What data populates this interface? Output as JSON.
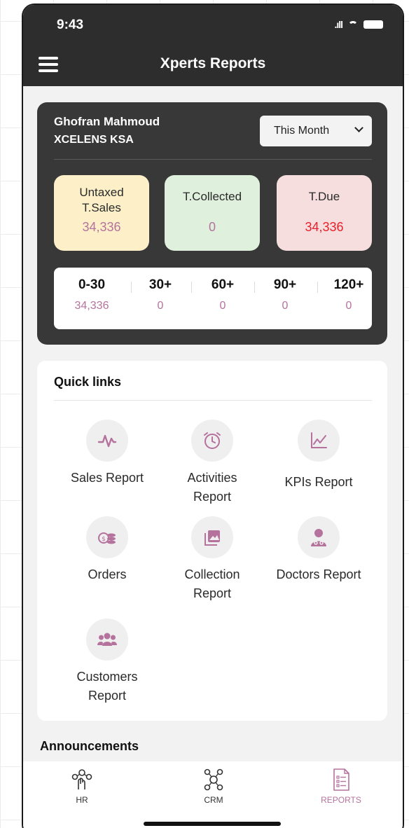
{
  "status_bar": {
    "time": "9:43",
    "signal": ".ıll"
  },
  "header": {
    "title": "Xperts Reports"
  },
  "summary": {
    "user_name": "Ghofran Mahmoud",
    "company": "XCELENS KSA",
    "period": "This Month",
    "stats": {
      "sales_label_1": "Untaxed",
      "sales_label_2": "T.Sales",
      "sales_value": "34,336",
      "collected_label": "T.Collected",
      "collected_value": "0",
      "due_label": "T.Due",
      "due_value": "34,336"
    },
    "aging": [
      {
        "bucket": "0-30",
        "amount": "34,336"
      },
      {
        "bucket": "30+",
        "amount": "0"
      },
      {
        "bucket": "60+",
        "amount": "0"
      },
      {
        "bucket": "90+",
        "amount": "0"
      },
      {
        "bucket": "120+",
        "amount": "0"
      }
    ]
  },
  "quick_links": {
    "title": "Quick links",
    "items": [
      {
        "label_1": "Sales Report",
        "label_2": "",
        "icon": "pulse-icon"
      },
      {
        "label_1": "Activities",
        "label_2": "Report",
        "icon": "alarm-clock-icon"
      },
      {
        "label_1": "KPIs Report",
        "label_2": "",
        "icon": "line-chart-icon"
      },
      {
        "label_1": "Orders",
        "label_2": "",
        "icon": "coins-icon"
      },
      {
        "label_1": "Collection",
        "label_2": "Report",
        "icon": "image-gallery-icon"
      },
      {
        "label_1": "Doctors Report",
        "label_2": "",
        "icon": "doctor-icon"
      },
      {
        "label_1": "Customers",
        "label_2": "Report",
        "icon": "users-icon"
      }
    ]
  },
  "announcements": {
    "title": "Announcements"
  },
  "bottom_nav": {
    "items": [
      {
        "label": "HR",
        "icon": "hr-network-icon",
        "active": false
      },
      {
        "label": "CRM",
        "icon": "crm-network-icon",
        "active": false
      },
      {
        "label": "REPORTS",
        "icon": "report-document-icon",
        "active": true
      }
    ]
  },
  "colors": {
    "header_bg": "#2d2d2d",
    "card_dark": "#383838",
    "accent_mauve": "#b4729d",
    "due_red": "#e8202a",
    "sales_bg": "#fdf0c9",
    "collected_bg": "#dff0dc",
    "due_bg": "#f6dede"
  }
}
